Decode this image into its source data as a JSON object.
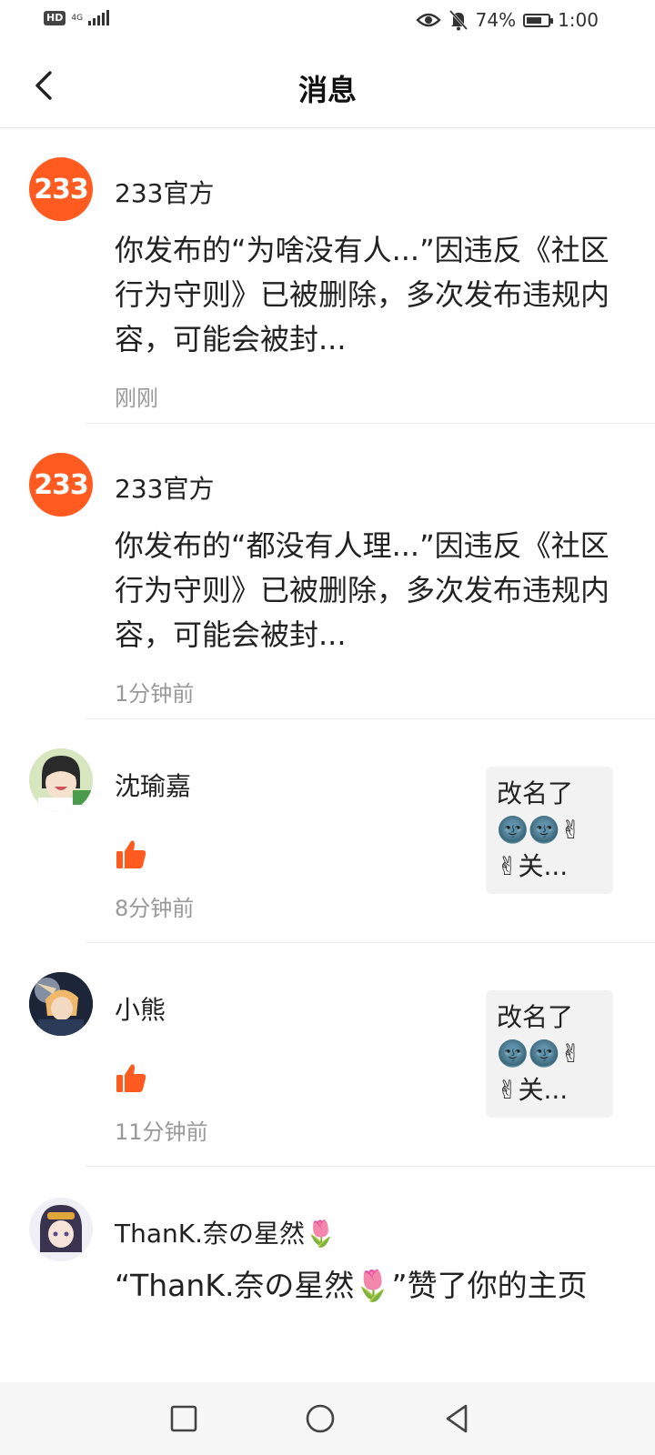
{
  "status": {
    "hd": "HD",
    "network": "4G",
    "battery_percent": "74%",
    "battery_level": 0.74,
    "time": "1:00"
  },
  "header": {
    "title": "消息"
  },
  "messages": [
    {
      "avatar_text": "233",
      "name": "233官方",
      "content": "你发布的“为啥没有人...”因违反《社区行为守则》已被删除，多次发布违规内容，可能会被封...",
      "time": "刚刚"
    },
    {
      "avatar_text": "233",
      "name": "233官方",
      "content": "你发布的“都没有人理...”因违反《社区行为守则》已被删除，多次发布违规内容，可能会被封...",
      "time": "1分钟前"
    },
    {
      "name": "沈瑜嘉",
      "time": "8分钟前",
      "thumb_text": "改名了🌚🌚✌✌关..."
    },
    {
      "name": "小熊",
      "time": "11分钟前",
      "thumb_text": "改名了🌚🌚✌✌关..."
    },
    {
      "name": "ThanK.奈の星然🌷",
      "content": "“ThanK.奈の星然🌷”赞了你的主页"
    }
  ],
  "colors": {
    "accent": "#ff5a1f",
    "like": "#ff5a1f",
    "time": "#999999"
  }
}
